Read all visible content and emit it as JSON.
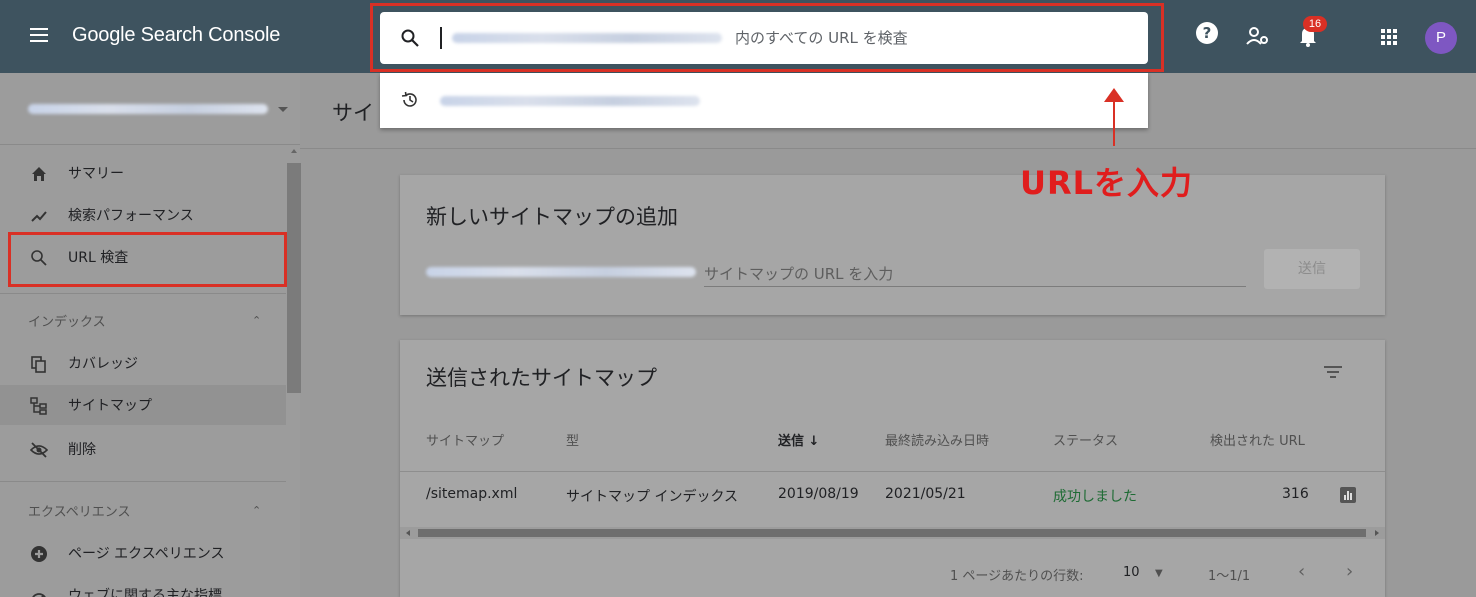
{
  "app": {
    "title": "Google Search Console"
  },
  "search": {
    "placeholder": "内のすべての URL を検査"
  },
  "top_icons": {
    "help_label": "?",
    "notifications_count": "16",
    "avatar_initial": "P"
  },
  "sidebar": {
    "items": [
      {
        "label": "サマリー",
        "icon": "home-icon"
      },
      {
        "label": "検索パフォーマンス",
        "icon": "trending-up-icon"
      },
      {
        "label": "URL 検査",
        "icon": "search-icon"
      }
    ],
    "index_section": {
      "title": "インデックス",
      "items": [
        {
          "label": "カバレッジ",
          "icon": "copy-icon"
        },
        {
          "label": "サイトマップ",
          "icon": "sitemap-icon"
        },
        {
          "label": "削除",
          "icon": "eye-off-icon"
        }
      ]
    },
    "experience_section": {
      "title": "エクスペリエンス",
      "items": [
        {
          "label": "ページ エクスペリエンス",
          "icon": "page-experience-icon"
        },
        {
          "label": "ウェブに関する主な指標",
          "icon": "speed-icon"
        }
      ]
    }
  },
  "main": {
    "page_title": "サイ"
  },
  "annotation": {
    "text": "URLを入力"
  },
  "add_sitemap": {
    "title": "新しいサイトマップの追加",
    "input_placeholder": "サイトマップの URL を入力",
    "submit_label": "送信"
  },
  "submitted": {
    "title": "送信されたサイトマップ",
    "columns": [
      "サイトマップ",
      "型",
      "送信 ↓",
      "最終読み込み日時",
      "ステータス",
      "検出された URL"
    ],
    "rows": [
      {
        "sitemap": "/sitemap.xml",
        "type": "サイトマップ インデックス",
        "submitted": "2019/08/19",
        "last_read": "2021/05/21",
        "status": "成功しました",
        "urls": "316"
      }
    ],
    "pager": {
      "rows_label": "1 ページあたりの行数:",
      "rows_value": "10",
      "range": "1〜1/1"
    }
  },
  "colors": {
    "topbar": "#3e535f",
    "highlight": "#d93025",
    "success": "#1e6b34",
    "avatar": "#7e57c2"
  }
}
